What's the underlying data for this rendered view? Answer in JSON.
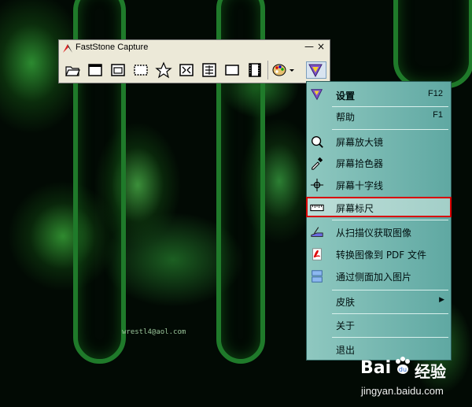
{
  "toolbar": {
    "title": "FastStone Capture",
    "min_label": "—",
    "close_label": "×",
    "buttons": [
      {
        "name": "open-folder-icon"
      },
      {
        "name": "capture-window-icon"
      },
      {
        "name": "capture-object-icon"
      },
      {
        "name": "capture-rectangle-icon"
      },
      {
        "name": "capture-freehand-icon"
      },
      {
        "name": "capture-fullscreen-icon"
      },
      {
        "name": "capture-scrolling-icon"
      },
      {
        "name": "capture-fixed-region-icon"
      },
      {
        "name": "screen-recorder-icon"
      },
      {
        "name": "output-palette-icon"
      },
      {
        "name": "settings-menu-icon"
      }
    ]
  },
  "menu": {
    "items": [
      {
        "label": "设置",
        "key": "F12",
        "bold": true
      },
      {
        "label": "帮助",
        "key": "F1"
      },
      {
        "label": "屏幕放大镜"
      },
      {
        "label": "屏幕拾色器"
      },
      {
        "label": "屏幕十字线"
      },
      {
        "label": "屏幕标尺"
      },
      {
        "label": "从扫描仪获取图像"
      },
      {
        "label": "转换图像到 PDF 文件"
      },
      {
        "label": "通过侧面加入图片"
      },
      {
        "label": "皮肤",
        "submenu": "▶"
      },
      {
        "label": "关于"
      },
      {
        "label": "退出"
      }
    ]
  },
  "background": {
    "email_text": "wrestl4@aol.com",
    "colors": {
      "accent": "#1f7a2a",
      "menu": "#6fb5ae",
      "highlight_border": "#d90000"
    }
  },
  "watermark": {
    "brand": "Bai",
    "brand2": "经验",
    "url": "jingyan.baidu.com"
  }
}
